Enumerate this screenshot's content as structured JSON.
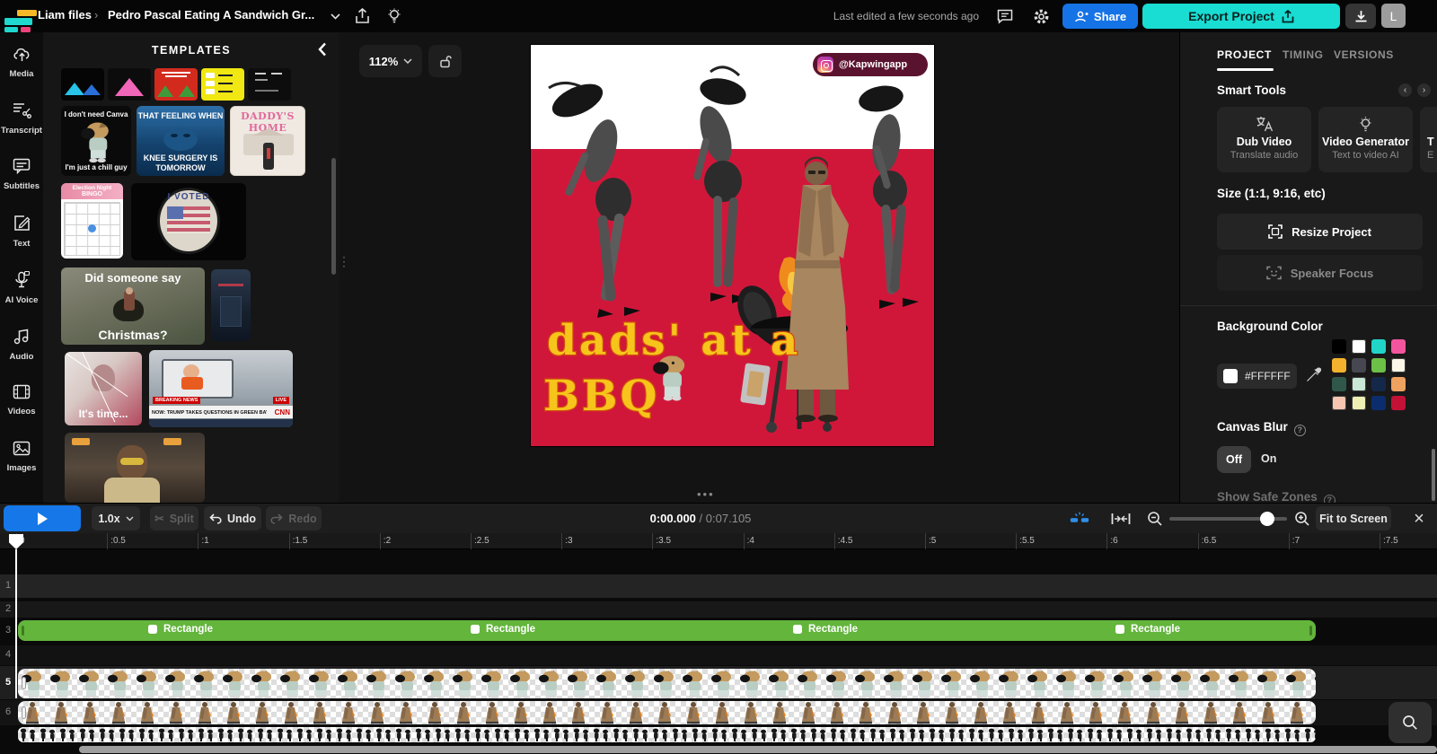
{
  "topbar": {
    "workspace": "Liam files",
    "separator": "›",
    "project_title": "Pedro Pascal Eating A Sandwich Gr...",
    "last_edited": "Last edited a few seconds ago",
    "share": "Share",
    "export": "Export Project",
    "avatar": "L"
  },
  "sidebar": {
    "items": [
      "Media",
      "Transcript",
      "Subtitles",
      "Text",
      "AI Voice",
      "Audio",
      "Videos",
      "Images"
    ]
  },
  "templates": {
    "title": "TEMPLATES",
    "chillguy": {
      "top": "I don't need Canva",
      "bottom": "I'm just a chill guy"
    },
    "grinch": {
      "top": "THAT FEELING WHEN",
      "bottom": "KNEE SURGERY IS TOMORROW"
    },
    "daddy": {
      "title": "DADDY'S HOME"
    },
    "bingo": {
      "line1": "Election Night",
      "line2": "BINGO"
    },
    "voted": {
      "title": "I VOTED"
    },
    "christmas": {
      "top": "Did someone say",
      "bottom": "Christmas?"
    },
    "mariah": {
      "caption": "It's time..."
    },
    "cnn": {
      "breaking": "BREAKING NEWS",
      "headline": "NOW: TRUMP TAKES QUESTIONS IN GREEN BAY, WISCONSIN",
      "logo": "CNN",
      "live": "LIVE"
    }
  },
  "canvas": {
    "zoom": "112%",
    "badge": "@Kapwingapp",
    "caption_line1": "dads' at a",
    "caption_line2": "BBQ",
    "background_red": "#d0173a"
  },
  "right_panel": {
    "tabs": [
      "PROJECT",
      "TIMING",
      "VERSIONS"
    ],
    "smart_tools": {
      "heading": "Smart Tools",
      "cards": [
        {
          "title": "Dub Video",
          "subtitle": "Translate audio"
        },
        {
          "title": "Video Generator",
          "subtitle": "Text to video AI"
        },
        {
          "title": "T",
          "subtitle": "E"
        }
      ]
    },
    "size_heading": "Size (1:1, 9:16, etc)",
    "resize": "Resize Project",
    "speaker_focus": "Speaker Focus",
    "background_color": {
      "heading": "Background Color",
      "hex": "#FFFFFF",
      "swatches": [
        "#000000",
        "#ffffff",
        "#20d5c8",
        "#f2559d",
        "#f2b22e",
        "#474752",
        "#6cbf47",
        "#fbf6e8",
        "#30584a",
        "#c9e8d5",
        "#14284a",
        "#efa15f",
        "#f8c5b0",
        "#eef0b4",
        "#0b2d6e",
        "#c31236"
      ]
    },
    "canvas_blur": {
      "heading": "Canvas Blur",
      "off": "Off",
      "on": "On"
    },
    "safe_zones": "Show Safe Zones"
  },
  "playback": {
    "speed": "1.0x",
    "split": "Split",
    "undo": "Undo",
    "redo": "Redo",
    "current_time": "0:00.000",
    "divider": "/",
    "total_time": "0:07.105",
    "fit_to_screen": "Fit to Screen"
  },
  "timeline": {
    "ruler_ticks": [
      "0",
      ":0.5",
      ":1",
      ":1.5",
      ":2",
      ":2.5",
      ":3",
      ":3.5",
      ":4",
      ":4.5",
      ":5",
      ":5.5",
      ":6",
      ":6.5",
      ":7",
      ":7.5"
    ],
    "tracks": [
      "1",
      "2",
      "3",
      "4",
      "5",
      "6"
    ],
    "selected_track": "5",
    "rectangle_clips": [
      {
        "label": "Rectangle",
        "offset": 145
      },
      {
        "label": "Rectangle",
        "offset": 504
      },
      {
        "label": "Rectangle",
        "offset": 863
      },
      {
        "label": "Rectangle",
        "offset": 1222
      }
    ]
  }
}
